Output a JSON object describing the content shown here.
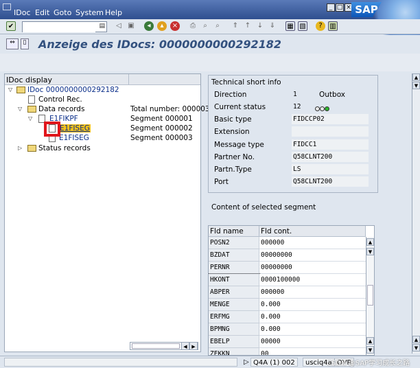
{
  "menu": {
    "items": [
      "IDoc",
      "Edit",
      "Goto",
      "System",
      "Help"
    ]
  },
  "window": {
    "logo_text": "SAP"
  },
  "toolbar": {
    "command_field_value": ""
  },
  "title": "Anzeige des IDocs: 0000000000292182",
  "tree": {
    "header": "IDoc display",
    "root": "IDoc 0000000000292182",
    "control_rec": "Control Rec.",
    "data_records": "Data records",
    "data_records_value": "Total number: 000003",
    "seg_header": "E1FIKPF",
    "seg_header_value": "Segment 000001",
    "seg_selected": "E1FISEG",
    "seg_selected_value": "Segment 000002",
    "seg_third": "E1FISEG",
    "seg_third_value": "Segment 000003",
    "status_records": "Status records"
  },
  "tech": {
    "title": "Technical short info",
    "direction_label": "Direction",
    "direction_code": "1",
    "direction_text": "Outbox",
    "status_label": "Current status",
    "status_value": "12",
    "basic_type_label": "Basic type",
    "basic_type_value": "FIDCCP02",
    "extension_label": "Extension",
    "extension_value": "",
    "message_type_label": "Message type",
    "message_type_value": "FIDCC1",
    "partner_label": "Partner No.",
    "partner_value": "Q58CLNT200",
    "partn_type_label": "Partn.Type",
    "partn_type_value": "LS",
    "port_label": "Port",
    "port_value": "Q58CLNT200",
    "status_lights": [
      "#e8e8e8",
      "#e8e8e8",
      "#2db82d"
    ]
  },
  "content": {
    "title": "Content of selected segment",
    "col_name": "Fld name",
    "col_value": "Fld cont.",
    "rows": [
      {
        "name": "POSN2",
        "value": "000000"
      },
      {
        "name": "BZDAT",
        "value": "00000000"
      },
      {
        "name": "PERNR",
        "value": "00000000"
      },
      {
        "name": "HKONT",
        "value": "0000100000"
      },
      {
        "name": "ABPER",
        "value": "000000"
      },
      {
        "name": "MENGE",
        "value": "0.000"
      },
      {
        "name": "ERFMG",
        "value": "0.000"
      },
      {
        "name": "BPMNG",
        "value": "0.000"
      },
      {
        "name": "EBELP",
        "value": "00000"
      },
      {
        "name": "ZEKKN",
        "value": "00"
      }
    ]
  },
  "status": {
    "system": "Q4A (1) 002",
    "host": "usciq4a",
    "mode": "OVR"
  },
  "watermark": "CSDN @SAP学习成长之路",
  "colors": {
    "title": "#33517f",
    "highlight": "#e0161c",
    "selected": "#f5c21a"
  }
}
